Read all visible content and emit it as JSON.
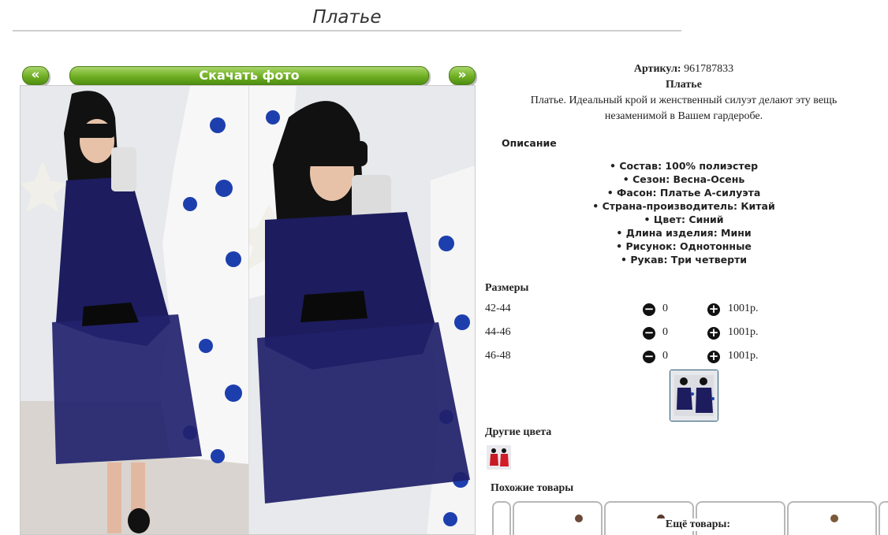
{
  "page_title": "Платье",
  "gallery": {
    "prev_label": "«",
    "download_label": "Скачать фото",
    "next_label": "»"
  },
  "product": {
    "article_label": "Артикул:",
    "article_value": "961787833",
    "name": "Платье",
    "description_line1": "Платье. Идеальный крой и женственный силуэт делают эту вещь",
    "description_line2": "незаменимой в Вашем гардеробе.",
    "desc_heading": "Описание",
    "props": [
      "Состав: 100% полиэстер",
      "Сезон: Весна-Осень",
      "Фасон: Платье А-силуэта",
      "Страна-производитель: Китай",
      "Цвет: Синий",
      "Длина изделия: Мини",
      "Рисунок: Однотонные",
      "Рукав: Три четверти"
    ]
  },
  "sizes_heading": "Размеры",
  "sizes": [
    {
      "label": "42-44",
      "qty": "0",
      "price": "1001р."
    },
    {
      "label": "44-46",
      "qty": "0",
      "price": "1001р."
    },
    {
      "label": "46-48",
      "qty": "0",
      "price": "1001р."
    }
  ],
  "other_colors_heading": "Другие цвета",
  "similar_heading": "Похожие товары",
  "more_label": "Ещё товары:",
  "colors": {
    "green": "#6fae22",
    "dress": "#1c1c5e",
    "tree": "#f4f4f4",
    "ornament": "#1d3fae"
  },
  "icons": {
    "minus": "minus-circle-icon",
    "plus": "plus-circle-icon"
  }
}
